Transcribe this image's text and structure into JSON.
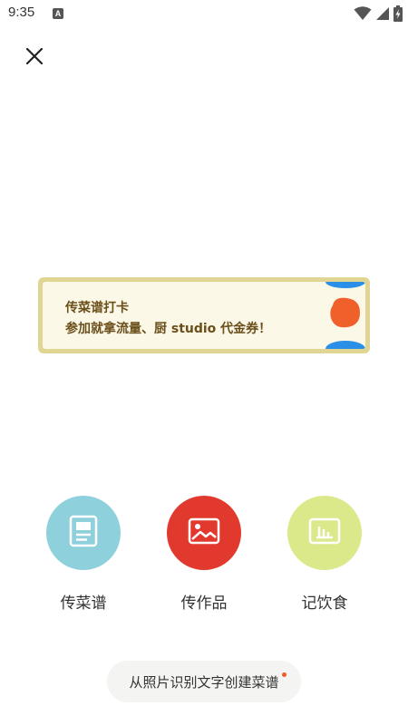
{
  "status_bar": {
    "time": "9:35",
    "app_icon_letter": "A",
    "icons": [
      "wifi-icon",
      "cell-signal-icon",
      "battery-charging-icon"
    ]
  },
  "close": {
    "icon": "close-icon"
  },
  "promo": {
    "title": "传菜谱打卡",
    "subtitle": "参加就拿流量、厨 studio 代金券！",
    "colors": {
      "border": "#e1d594",
      "background": "#fcf8e8",
      "text": "#6b4f1a",
      "deco_orange": "#f0602a",
      "deco_blue": "#2a8fe6"
    }
  },
  "actions": [
    {
      "label": "传菜谱",
      "icon": "recipe-document-icon",
      "color": "#8fd0dd"
    },
    {
      "label": "传作品",
      "icon": "image-icon",
      "color": "#e2392e"
    },
    {
      "label": "记饮食",
      "icon": "chart-icon",
      "color": "#dbe98a"
    }
  ],
  "ocr_button": {
    "label": "从照片识别文字创建菜谱",
    "badge_color": "#ef5a2c"
  }
}
